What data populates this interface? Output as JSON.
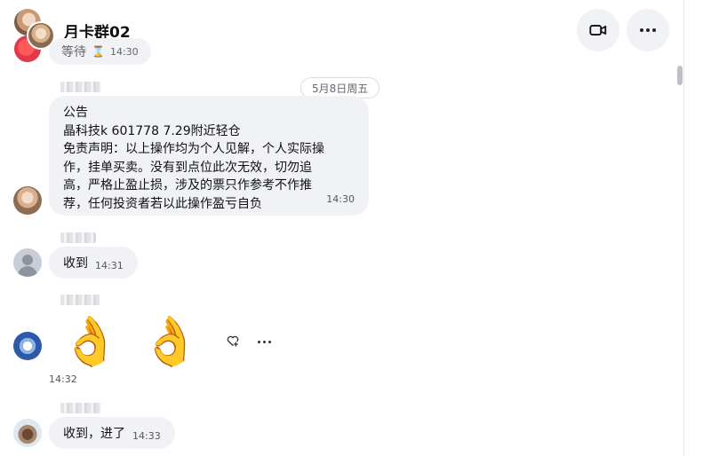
{
  "header": {
    "title": "月卡群02",
    "pending_message": {
      "text": "等待",
      "icon": "hourglass-icon",
      "time": "14:30"
    },
    "actions": [
      {
        "name": "video-call",
        "icon": "video-camera-icon"
      },
      {
        "name": "more-options",
        "icon": "more-horizontal-icon"
      }
    ]
  },
  "date_separator": "5月8日周五",
  "messages": [
    {
      "type": "announcement",
      "lines": [
        "公告",
        "晶科技k 601778 7.29附近轻仓",
        "免责声明：以上操作均为个人见解，个人实际操",
        "作，挂单买卖。没有到点位此次无效，切勿追",
        "高，严格止盈止损，涉及的票只作参考不作推",
        "荐，任何投资者若以此操作盈亏自负"
      ],
      "time": "14:30",
      "avatar": "profile-photo-woman"
    },
    {
      "type": "text",
      "text": "收到",
      "time": "14:31",
      "avatar": "default-user-icon"
    },
    {
      "type": "emoji",
      "emojis": [
        "👌",
        "👌"
      ],
      "time": "14:32",
      "avatar": "cloud-avatar",
      "actions": [
        "react-heart-plus-icon",
        "more-horizontal-icon"
      ]
    },
    {
      "type": "text",
      "text": "收到，进了",
      "time": "14:33",
      "avatar": "otter-avatar"
    }
  ],
  "colors": {
    "bubble_bg": "#f0f2f5",
    "header_button_bg": "#f0f2f5",
    "text_primary": "#111111",
    "text_secondary": "#65676b",
    "emoji_yellow": "#f7c93e"
  }
}
